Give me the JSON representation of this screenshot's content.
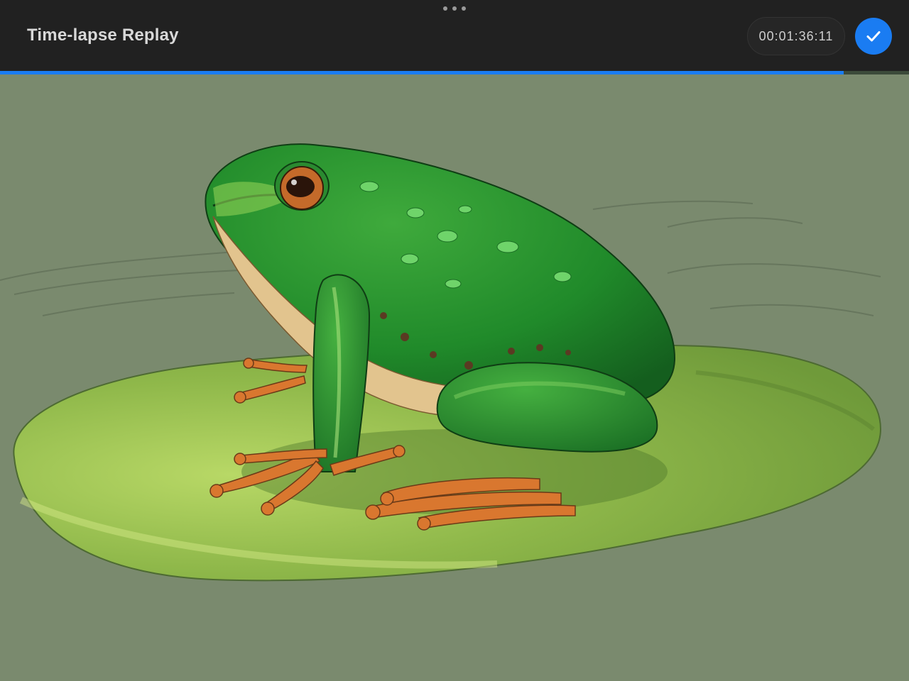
{
  "header": {
    "title": "Time-lapse Replay",
    "timecode": "00:01:36:11",
    "done_icon": "checkmark-icon",
    "grabber_icon": "more-dots-icon"
  },
  "playback": {
    "progress": 0.928
  },
  "colors": {
    "accent": "#1a7cf2",
    "topbar": "#212121",
    "canvas_background": "#7a8a6e"
  }
}
